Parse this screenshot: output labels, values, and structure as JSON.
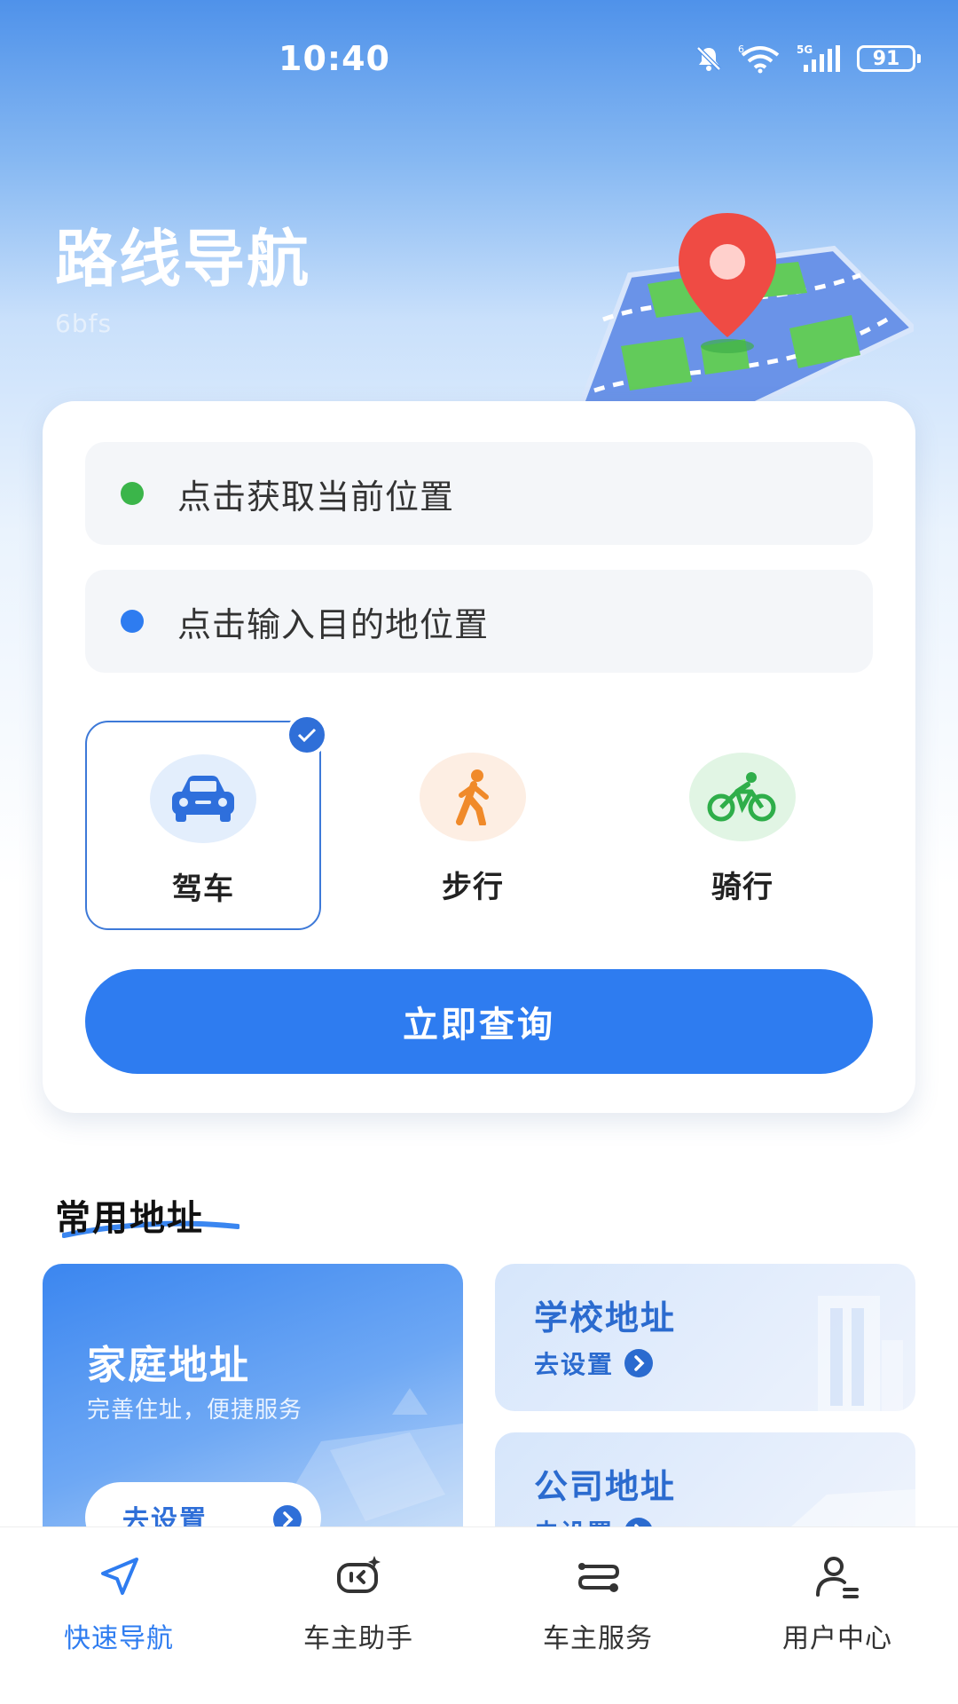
{
  "status_bar": {
    "time": "10:40",
    "network": "5G",
    "wifi_badge": "6",
    "battery": "91"
  },
  "header": {
    "title": "路线导航",
    "subtitle": "6bfs",
    "illustration_icon": "map-pin-illustration-icon"
  },
  "route_card": {
    "origin_placeholder": "点击获取当前位置",
    "destination_placeholder": "点击输入目的地位置",
    "origin_dot_color": "#3bb54a",
    "destination_dot_color": "#2e7cf0",
    "modes": [
      {
        "label": "驾车",
        "icon": "car-icon",
        "selected": true
      },
      {
        "label": "步行",
        "icon": "walking-person-icon",
        "selected": false
      },
      {
        "label": "骑行",
        "icon": "bicycle-icon",
        "selected": false
      }
    ],
    "query_button": "立即查询"
  },
  "common_addresses": {
    "section_title": "常用地址",
    "home": {
      "title": "家庭地址",
      "subtitle": "完善住址，便捷服务",
      "action": "去设置"
    },
    "school": {
      "title": "学校地址",
      "action": "去设置"
    },
    "company": {
      "title": "公司地址",
      "action": "去设置"
    }
  },
  "tab_bar": {
    "items": [
      {
        "label": "快速导航",
        "icon": "navigation-arrow-icon",
        "active": true
      },
      {
        "label": "车主助手",
        "icon": "assistant-icon",
        "active": false
      },
      {
        "label": "车主服务",
        "icon": "route-service-icon",
        "active": false
      },
      {
        "label": "用户中心",
        "icon": "user-icon",
        "active": false
      }
    ]
  },
  "colors": {
    "accent": "#2e7cf0",
    "accent_dark": "#2b6bcf",
    "field_bg": "#f4f6f9"
  }
}
